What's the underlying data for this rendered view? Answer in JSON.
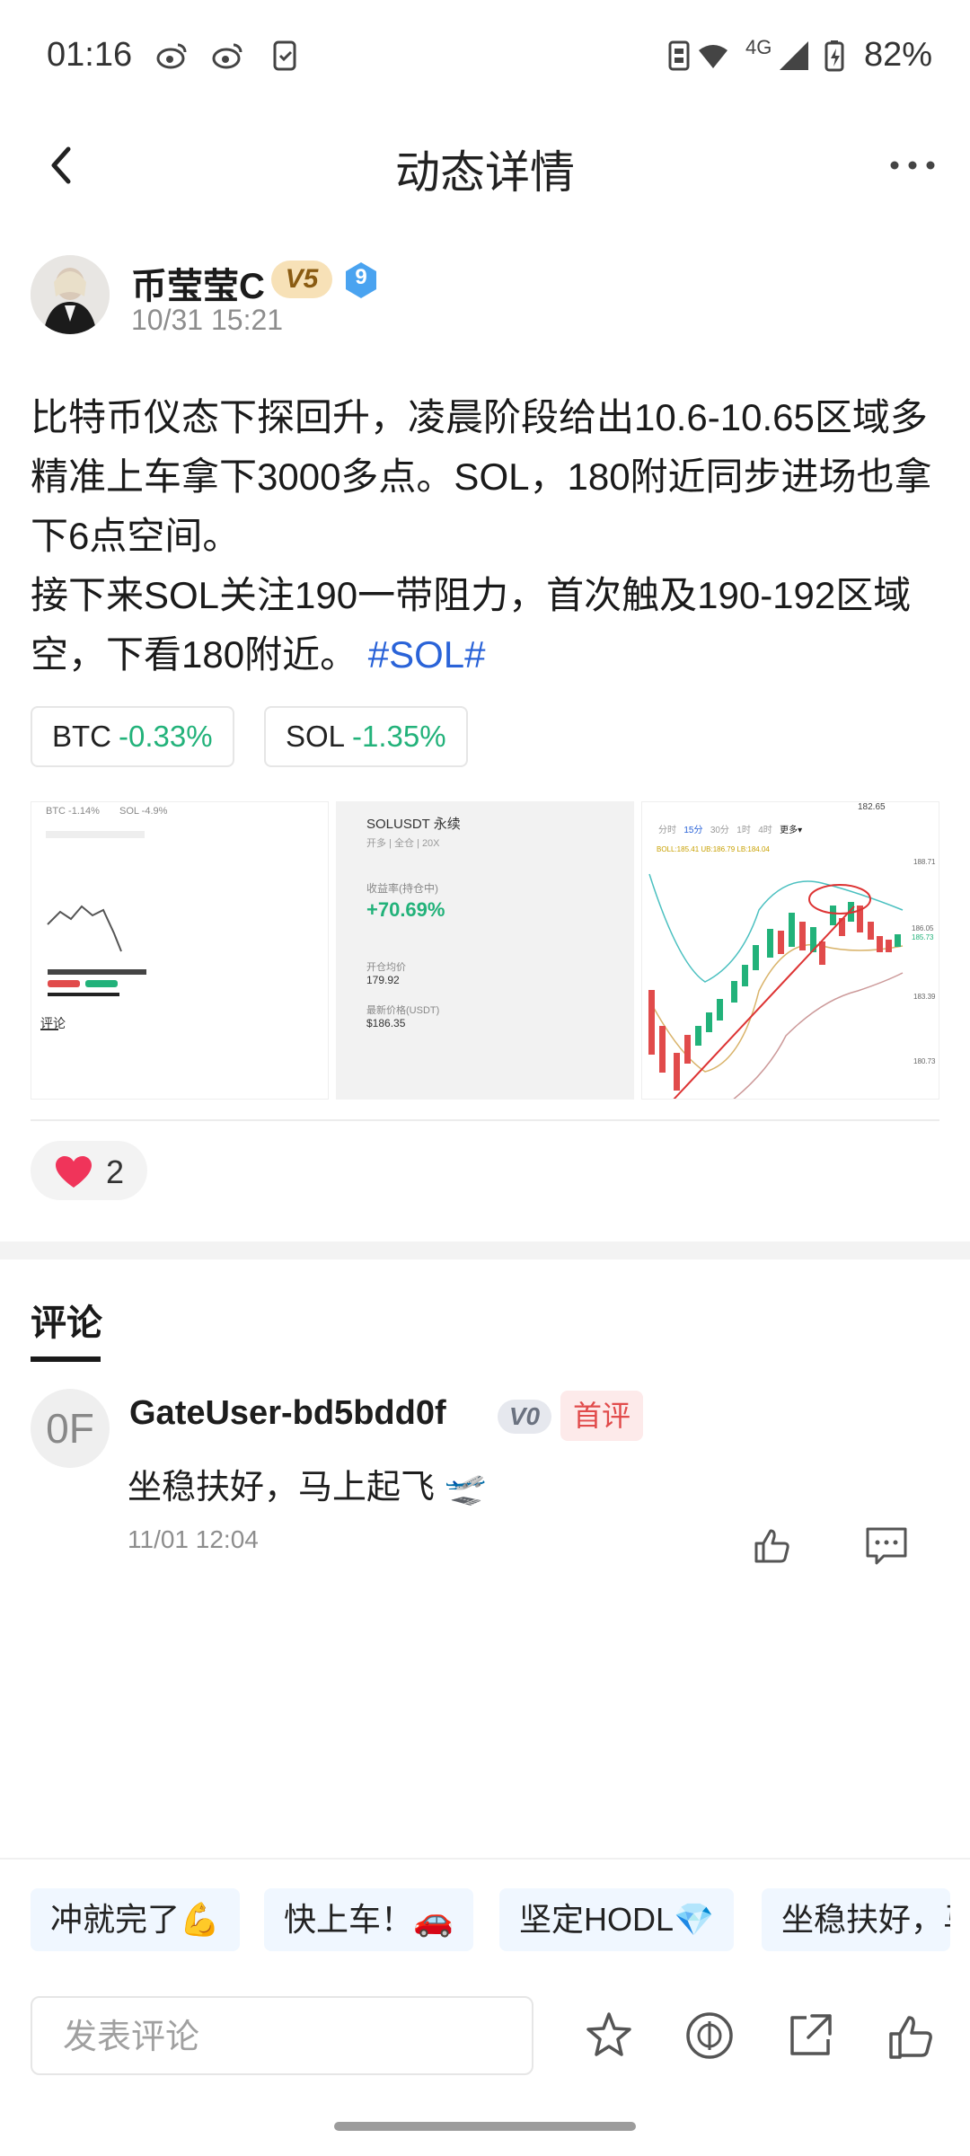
{
  "status_bar": {
    "time": "01:16",
    "network": "4G",
    "battery": "82%"
  },
  "header": {
    "title": "动态详情"
  },
  "post": {
    "author": "币莹莹C",
    "vip": "V5",
    "level": "9",
    "time": "10/31 15:21",
    "paragraph1": "比特币仪态下探回升，凌晨阶段给出10.6-10.65区域多精准上车拿下3000多点。SOL，180附近同步进场也拿下6点空间。",
    "paragraph2": "接下来SOL关注190一带阻力，首次触及190-192区域空，下看180附近。",
    "hashtag": "#SOL#",
    "tickers": [
      {
        "symbol": "BTC",
        "change": "-0.33%"
      },
      {
        "symbol": "SOL",
        "change": "-1.35%"
      }
    ],
    "images": {
      "img1": {
        "tag1": "BTC -1.14%",
        "tag2": "SOL -4.9%",
        "label": "评论"
      },
      "img2": {
        "pair": "SOLUSDT 永续",
        "sub": "开多 | 全仓 | 20X",
        "roi_label": "收益率(持仓中)",
        "roi": "+70.69%",
        "entry_label": "开仓均价",
        "entry": "179.92",
        "last_label": "最新价格(USDT)",
        "last": "$186.35"
      },
      "img3": {
        "tabs": [
          "分时",
          "15分",
          "30分",
          "1时",
          "4时",
          "更多▾"
        ],
        "boll": "BOLL:185.41  UB:186.79  LB:184.04",
        "ticks": [
          "182.65",
          "188.71",
          "186.05",
          "185.73",
          "183.39",
          "180.73"
        ]
      }
    },
    "likes": "2"
  },
  "comments": {
    "title": "评论",
    "items": [
      {
        "avatar_text": "0F",
        "user": "GateUser-bd5bdd0f",
        "vip": "V0",
        "badge": "首评",
        "text": "坐稳扶好，马上起飞 🛫",
        "time": "11/01 12:04"
      }
    ]
  },
  "quick_replies": [
    "冲就完了💪",
    "快上车！🚗",
    "坚定HODL💎",
    "坐稳扶好，马上起飞"
  ],
  "bottom_bar": {
    "placeholder": "发表评论"
  },
  "colors": {
    "up_green": "#22b27a",
    "link_blue": "#2a63d8",
    "badge_red": "#e14b4b"
  }
}
